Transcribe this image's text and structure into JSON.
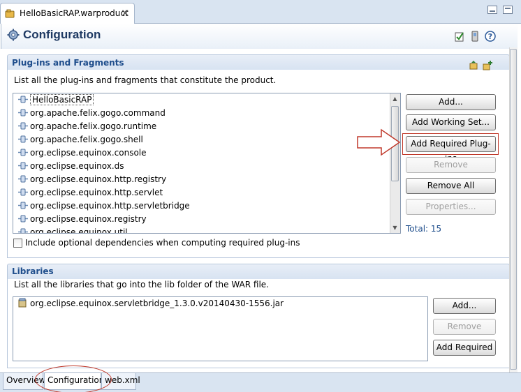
{
  "editor": {
    "tab_title": "HelloBasicRAP.warproduct",
    "close_glyph": "✕"
  },
  "form": {
    "title": "Configuration",
    "icons": [
      "gear-icon",
      "validate-icon",
      "export-icon",
      "help-icon"
    ]
  },
  "plugins_section": {
    "title": "Plug-ins and Fragments",
    "description": "List all the plug-ins and fragments that constitute the product.",
    "items": [
      "HelloBasicRAP",
      "org.apache.felix.gogo.command",
      "org.apache.felix.gogo.runtime",
      "org.apache.felix.gogo.shell",
      "org.eclipse.equinox.console",
      "org.eclipse.equinox.ds",
      "org.eclipse.equinox.http.registry",
      "org.eclipse.equinox.http.servlet",
      "org.eclipse.equinox.http.servletbridge",
      "org.eclipse.equinox.registry",
      "org.eclipse.equinox.util"
    ],
    "buttons": {
      "add": "Add...",
      "add_working_set": "Add Working Set...",
      "add_required": "Add Required Plug-ins",
      "remove": "Remove",
      "remove_all": "Remove All",
      "properties": "Properties..."
    },
    "total": "Total: 15",
    "optional_deps_label": "Include optional dependencies when computing required plug-ins",
    "optional_deps_checked": false
  },
  "libraries_section": {
    "title": "Libraries",
    "description": "List all the libraries that go into the lib folder of the WAR file.",
    "items": [
      "org.eclipse.equinox.servletbridge_1.3.0.v20140430-1556.jar"
    ],
    "buttons": {
      "add": "Add...",
      "remove": "Remove",
      "add_required": "Add Required"
    }
  },
  "page_tabs": [
    {
      "label": "Overview",
      "active": false
    },
    {
      "label": "Configuration",
      "active": true
    },
    {
      "label": "web.xml",
      "active": false
    }
  ],
  "colors": {
    "accent": "#1f4e8c",
    "annotation": "#c0392b",
    "header_bg": "#d9e4f1"
  }
}
